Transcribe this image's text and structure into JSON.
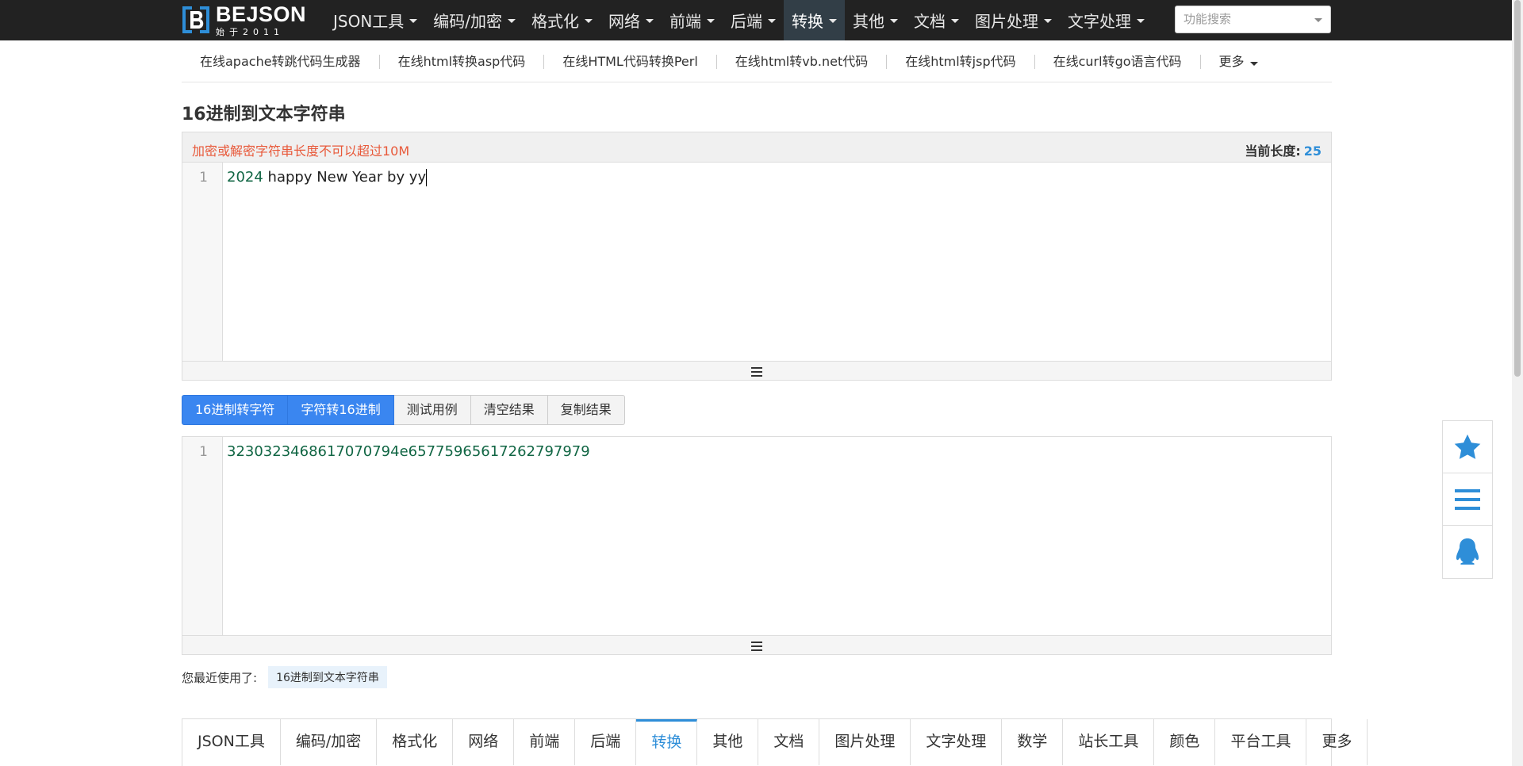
{
  "brand": {
    "name": "BEJSON",
    "sub": "始于2011",
    "colors": {
      "mark": "#2e8ed8"
    }
  },
  "nav": {
    "items": [
      {
        "label": "JSON工具",
        "icon": "caret-down-icon"
      },
      {
        "label": "编码/加密",
        "icon": "caret-down-icon"
      },
      {
        "label": "格式化",
        "icon": "caret-down-icon"
      },
      {
        "label": "网络",
        "icon": "caret-down-icon"
      },
      {
        "label": "前端",
        "icon": "caret-down-icon"
      },
      {
        "label": "后端",
        "icon": "caret-down-icon"
      },
      {
        "label": "转换",
        "icon": "caret-down-icon",
        "active": true
      },
      {
        "label": "其他",
        "icon": "caret-down-icon"
      },
      {
        "label": "文档",
        "icon": "caret-down-icon"
      },
      {
        "label": "图片处理",
        "icon": "caret-down-icon"
      },
      {
        "label": "文字处理",
        "icon": "caret-down-icon"
      }
    ],
    "search_placeholder": "功能搜索"
  },
  "sublinks": [
    "在线apache转跳代码生成器",
    "在线html转换asp代码",
    "在线HTML代码转换Perl",
    "在线html转vb.net代码",
    "在线html转jsp代码",
    "在线curl转go语言代码",
    "更多"
  ],
  "page": {
    "title": "16进制到文本字符串"
  },
  "input_panel": {
    "warning": "加密或解密字符串长度不可以超过10M",
    "length_label": "当前长度:",
    "length_value": "25",
    "line_number": "1",
    "text_num": "2024",
    "text_rest": " happy New Year by yy"
  },
  "buttons": [
    "16进制转字符",
    "字符转16进制",
    "测试用例",
    "清空结果",
    "复制结果"
  ],
  "output_panel": {
    "line_number": "1",
    "text": "3230323468617070794e65775965617262797979"
  },
  "recent": {
    "label": "您最近使用了:",
    "tag": "16进制到文本字符串"
  },
  "bottom_tabs": [
    "JSON工具",
    "编码/加密",
    "格式化",
    "网络",
    "前端",
    "后端",
    "转换",
    "其他",
    "文档",
    "图片处理",
    "文字处理",
    "数学",
    "站长工具",
    "颜色",
    "平台工具",
    "更多"
  ],
  "bottom_tabs_active": "转换",
  "float_bar": {
    "icons": [
      "star-icon",
      "menu-icon",
      "qq-penguin-icon"
    ],
    "color": "#2e8ed8"
  }
}
